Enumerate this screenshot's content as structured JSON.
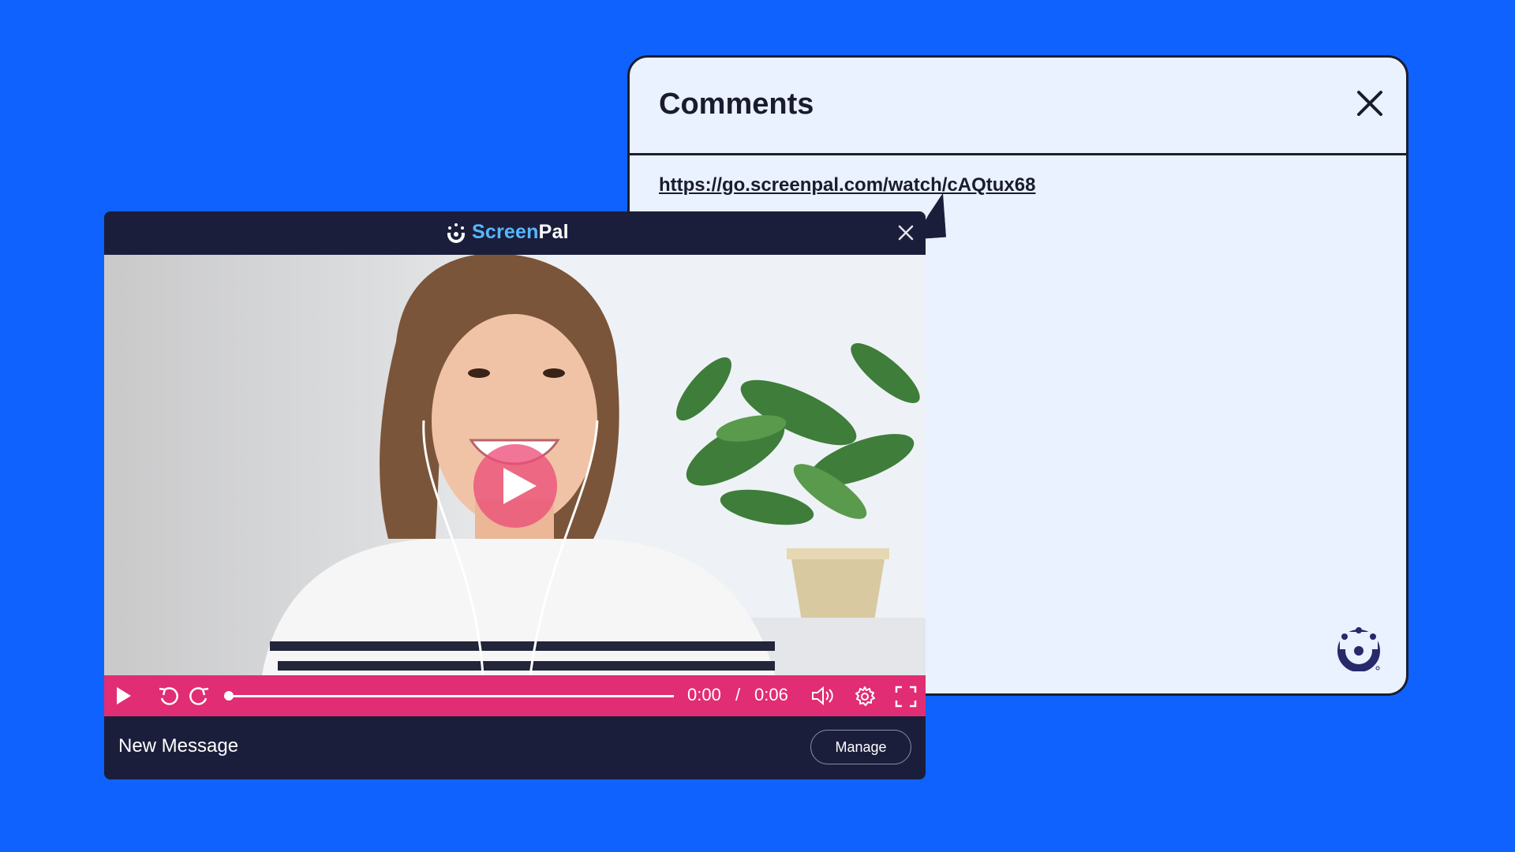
{
  "comments": {
    "title": "Comments",
    "link": "https://go.screenpal.com/watch/cAQtux68",
    "close_icon": "close-icon",
    "brand_icon": "screenpal-logo-icon"
  },
  "player": {
    "logo_screen": "Screen",
    "logo_pal": "Pal",
    "time_current": "0:00",
    "time_separator": "/",
    "time_total": "0:06",
    "progress": 0.0,
    "message_title": "New Message",
    "manage_label": "Manage",
    "colors": {
      "frame": "#1b1e3b",
      "controls": "#e12d73",
      "accent": "#58b7ff"
    }
  },
  "background_color": "#0f62fe"
}
